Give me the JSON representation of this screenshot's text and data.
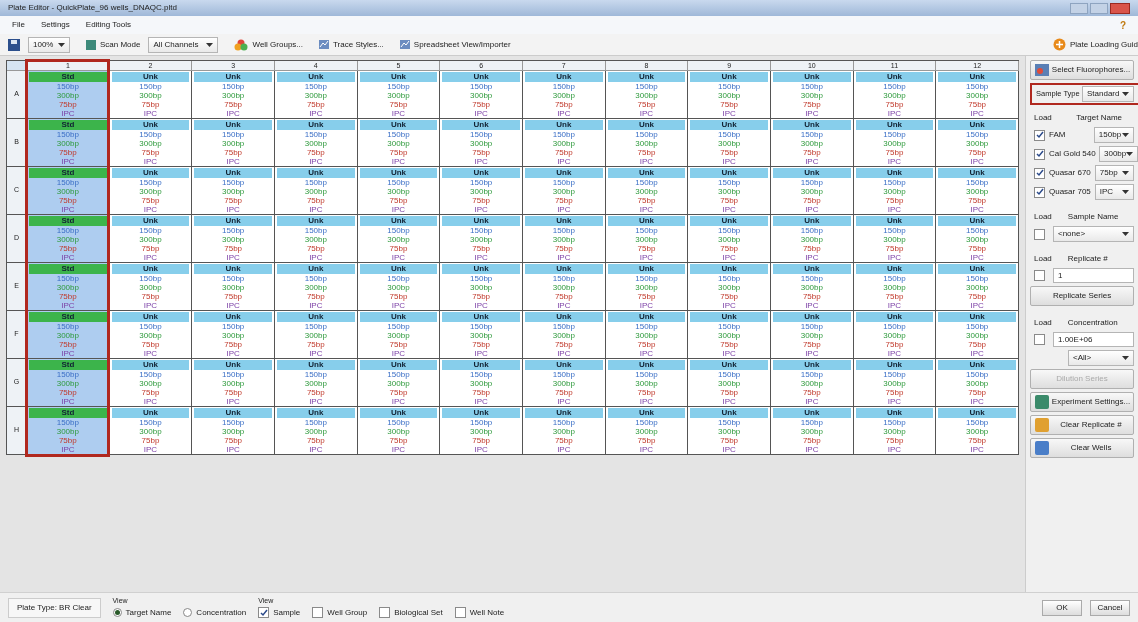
{
  "window": {
    "title": "Plate Editor - QuickPlate_96 wells_DNAQC.pltd"
  },
  "menu": [
    {
      "label": "File"
    },
    {
      "label": "Settings"
    },
    {
      "label": "Editing Tools"
    }
  ],
  "help": "?",
  "toolbar": {
    "zoom": "100%",
    "scan_mode_label": "Scan Mode",
    "scan_mode": "All Channels",
    "buttons": [
      "Well Groups...",
      "Trace Styles...",
      "Spreadsheet View/Importer"
    ],
    "guide": "Plate Loading Guid"
  },
  "columns": [
    "1",
    "2",
    "3",
    "4",
    "5",
    "6",
    "7",
    "8",
    "9",
    "10",
    "11",
    "12"
  ],
  "rows": [
    {
      "label": "A",
      "wells": [
        {
          "kind": "std",
          "label": "Std",
          "selected": true,
          "targets": [
            "150bp",
            "300bp",
            "75bp",
            "IPC"
          ]
        },
        {
          "kind": "unk",
          "label": "Unk",
          "selected": false,
          "targets": [
            "150bp",
            "300bp",
            "75bp",
            "IPC"
          ]
        },
        {
          "kind": "unk",
          "label": "Unk",
          "selected": false,
          "targets": [
            "150bp",
            "300bp",
            "75bp",
            "IPC"
          ]
        },
        {
          "kind": "unk",
          "label": "Unk",
          "selected": false,
          "targets": [
            "150bp",
            "300bp",
            "75bp",
            "IPC"
          ]
        },
        {
          "kind": "unk",
          "label": "Unk",
          "selected": false,
          "targets": [
            "150bp",
            "300bp",
            "75bp",
            "IPC"
          ]
        },
        {
          "kind": "unk",
          "label": "Unk",
          "selected": false,
          "targets": [
            "150bp",
            "300bp",
            "75bp",
            "IPC"
          ]
        },
        {
          "kind": "unk",
          "label": "Unk",
          "selected": false,
          "targets": [
            "150bp",
            "300bp",
            "75bp",
            "IPC"
          ]
        },
        {
          "kind": "unk",
          "label": "Unk",
          "selected": false,
          "targets": [
            "150bp",
            "300bp",
            "75bp",
            "IPC"
          ]
        },
        {
          "kind": "unk",
          "label": "Unk",
          "selected": false,
          "targets": [
            "150bp",
            "300bp",
            "75bp",
            "IPC"
          ]
        },
        {
          "kind": "unk",
          "label": "Unk",
          "selected": false,
          "targets": [
            "150bp",
            "300bp",
            "75bp",
            "IPC"
          ]
        },
        {
          "kind": "unk",
          "label": "Unk",
          "selected": false,
          "targets": [
            "150bp",
            "300bp",
            "75bp",
            "IPC"
          ]
        },
        {
          "kind": "unk",
          "label": "Unk",
          "selected": false,
          "targets": [
            "150bp",
            "300bp",
            "75bp",
            "IPC"
          ]
        }
      ]
    },
    {
      "label": "B",
      "wells": [
        {
          "kind": "std",
          "label": "Std",
          "selected": true,
          "targets": [
            "150bp",
            "300bp",
            "75bp",
            "IPC"
          ]
        },
        {
          "kind": "unk",
          "label": "Unk",
          "selected": false,
          "targets": [
            "150bp",
            "300bp",
            "75bp",
            "IPC"
          ]
        },
        {
          "kind": "unk",
          "label": "Unk",
          "selected": false,
          "targets": [
            "150bp",
            "300bp",
            "75bp",
            "IPC"
          ]
        },
        {
          "kind": "unk",
          "label": "Unk",
          "selected": false,
          "targets": [
            "150bp",
            "300bp",
            "75bp",
            "IPC"
          ]
        },
        {
          "kind": "unk",
          "label": "Unk",
          "selected": false,
          "targets": [
            "150bp",
            "300bp",
            "75bp",
            "IPC"
          ]
        },
        {
          "kind": "unk",
          "label": "Unk",
          "selected": false,
          "targets": [
            "150bp",
            "300bp",
            "75bp",
            "IPC"
          ]
        },
        {
          "kind": "unk",
          "label": "Unk",
          "selected": false,
          "targets": [
            "150bp",
            "300bp",
            "75bp",
            "IPC"
          ]
        },
        {
          "kind": "unk",
          "label": "Unk",
          "selected": false,
          "targets": [
            "150bp",
            "300bp",
            "75bp",
            "IPC"
          ]
        },
        {
          "kind": "unk",
          "label": "Unk",
          "selected": false,
          "targets": [
            "150bp",
            "300bp",
            "75bp",
            "IPC"
          ]
        },
        {
          "kind": "unk",
          "label": "Unk",
          "selected": false,
          "targets": [
            "150bp",
            "300bp",
            "75bp",
            "IPC"
          ]
        },
        {
          "kind": "unk",
          "label": "Unk",
          "selected": false,
          "targets": [
            "150bp",
            "300bp",
            "75bp",
            "IPC"
          ]
        },
        {
          "kind": "unk",
          "label": "Unk",
          "selected": false,
          "targets": [
            "150bp",
            "300bp",
            "75bp",
            "IPC"
          ]
        }
      ]
    },
    {
      "label": "C",
      "wells": [
        {
          "kind": "std",
          "label": "Std",
          "selected": true,
          "targets": [
            "150bp",
            "300bp",
            "75bp",
            "IPC"
          ]
        },
        {
          "kind": "unk",
          "label": "Unk",
          "selected": false,
          "targets": [
            "150bp",
            "300bp",
            "75bp",
            "IPC"
          ]
        },
        {
          "kind": "unk",
          "label": "Unk",
          "selected": false,
          "targets": [
            "150bp",
            "300bp",
            "75bp",
            "IPC"
          ]
        },
        {
          "kind": "unk",
          "label": "Unk",
          "selected": false,
          "targets": [
            "150bp",
            "300bp",
            "75bp",
            "IPC"
          ]
        },
        {
          "kind": "unk",
          "label": "Unk",
          "selected": false,
          "targets": [
            "150bp",
            "300bp",
            "75bp",
            "IPC"
          ]
        },
        {
          "kind": "unk",
          "label": "Unk",
          "selected": false,
          "targets": [
            "150bp",
            "300bp",
            "75bp",
            "IPC"
          ]
        },
        {
          "kind": "unk",
          "label": "Unk",
          "selected": false,
          "targets": [
            "150bp",
            "300bp",
            "75bp",
            "IPC"
          ]
        },
        {
          "kind": "unk",
          "label": "Unk",
          "selected": false,
          "targets": [
            "150bp",
            "300bp",
            "75bp",
            "IPC"
          ]
        },
        {
          "kind": "unk",
          "label": "Unk",
          "selected": false,
          "targets": [
            "150bp",
            "300bp",
            "75bp",
            "IPC"
          ]
        },
        {
          "kind": "unk",
          "label": "Unk",
          "selected": false,
          "targets": [
            "150bp",
            "300bp",
            "75bp",
            "IPC"
          ]
        },
        {
          "kind": "unk",
          "label": "Unk",
          "selected": false,
          "targets": [
            "150bp",
            "300bp",
            "75bp",
            "IPC"
          ]
        },
        {
          "kind": "unk",
          "label": "Unk",
          "selected": false,
          "targets": [
            "150bp",
            "300bp",
            "75bp",
            "IPC"
          ]
        }
      ]
    },
    {
      "label": "D",
      "wells": [
        {
          "kind": "std",
          "label": "Std",
          "selected": true,
          "targets": [
            "150bp",
            "300bp",
            "75bp",
            "IPC"
          ]
        },
        {
          "kind": "unk",
          "label": "Unk",
          "selected": false,
          "targets": [
            "150bp",
            "300bp",
            "75bp",
            "IPC"
          ]
        },
        {
          "kind": "unk",
          "label": "Unk",
          "selected": false,
          "targets": [
            "150bp",
            "300bp",
            "75bp",
            "IPC"
          ]
        },
        {
          "kind": "unk",
          "label": "Unk",
          "selected": false,
          "targets": [
            "150bp",
            "300bp",
            "75bp",
            "IPC"
          ]
        },
        {
          "kind": "unk",
          "label": "Unk",
          "selected": false,
          "targets": [
            "150bp",
            "300bp",
            "75bp",
            "IPC"
          ]
        },
        {
          "kind": "unk",
          "label": "Unk",
          "selected": false,
          "targets": [
            "150bp",
            "300bp",
            "75bp",
            "IPC"
          ]
        },
        {
          "kind": "unk",
          "label": "Unk",
          "selected": false,
          "targets": [
            "150bp",
            "300bp",
            "75bp",
            "IPC"
          ]
        },
        {
          "kind": "unk",
          "label": "Unk",
          "selected": false,
          "targets": [
            "150bp",
            "300bp",
            "75bp",
            "IPC"
          ]
        },
        {
          "kind": "unk",
          "label": "Unk",
          "selected": false,
          "targets": [
            "150bp",
            "300bp",
            "75bp",
            "IPC"
          ]
        },
        {
          "kind": "unk",
          "label": "Unk",
          "selected": false,
          "targets": [
            "150bp",
            "300bp",
            "75bp",
            "IPC"
          ]
        },
        {
          "kind": "unk",
          "label": "Unk",
          "selected": false,
          "targets": [
            "150bp",
            "300bp",
            "75bp",
            "IPC"
          ]
        },
        {
          "kind": "unk",
          "label": "Unk",
          "selected": false,
          "targets": [
            "150bp",
            "300bp",
            "75bp",
            "IPC"
          ]
        }
      ]
    },
    {
      "label": "E",
      "wells": [
        {
          "kind": "std",
          "label": "Std",
          "selected": true,
          "targets": [
            "150bp",
            "300bp",
            "75bp",
            "IPC"
          ]
        },
        {
          "kind": "unk",
          "label": "Unk",
          "selected": false,
          "targets": [
            "150bp",
            "300bp",
            "75bp",
            "IPC"
          ]
        },
        {
          "kind": "unk",
          "label": "Unk",
          "selected": false,
          "targets": [
            "150bp",
            "300bp",
            "75bp",
            "IPC"
          ]
        },
        {
          "kind": "unk",
          "label": "Unk",
          "selected": false,
          "targets": [
            "150bp",
            "300bp",
            "75bp",
            "IPC"
          ]
        },
        {
          "kind": "unk",
          "label": "Unk",
          "selected": false,
          "targets": [
            "150bp",
            "300bp",
            "75bp",
            "IPC"
          ]
        },
        {
          "kind": "unk",
          "label": "Unk",
          "selected": false,
          "targets": [
            "150bp",
            "300bp",
            "75bp",
            "IPC"
          ]
        },
        {
          "kind": "unk",
          "label": "Unk",
          "selected": false,
          "targets": [
            "150bp",
            "300bp",
            "75bp",
            "IPC"
          ]
        },
        {
          "kind": "unk",
          "label": "Unk",
          "selected": false,
          "targets": [
            "150bp",
            "300bp",
            "75bp",
            "IPC"
          ]
        },
        {
          "kind": "unk",
          "label": "Unk",
          "selected": false,
          "targets": [
            "150bp",
            "300bp",
            "75bp",
            "IPC"
          ]
        },
        {
          "kind": "unk",
          "label": "Unk",
          "selected": false,
          "targets": [
            "150bp",
            "300bp",
            "75bp",
            "IPC"
          ]
        },
        {
          "kind": "unk",
          "label": "Unk",
          "selected": false,
          "targets": [
            "150bp",
            "300bp",
            "75bp",
            "IPC"
          ]
        },
        {
          "kind": "unk",
          "label": "Unk",
          "selected": false,
          "targets": [
            "150bp",
            "300bp",
            "75bp",
            "IPC"
          ]
        }
      ]
    },
    {
      "label": "F",
      "wells": [
        {
          "kind": "std",
          "label": "Std",
          "selected": true,
          "targets": [
            "150bp",
            "300bp",
            "75bp",
            "IPC"
          ]
        },
        {
          "kind": "unk",
          "label": "Unk",
          "selected": false,
          "targets": [
            "150bp",
            "300bp",
            "75bp",
            "IPC"
          ]
        },
        {
          "kind": "unk",
          "label": "Unk",
          "selected": false,
          "targets": [
            "150bp",
            "300bp",
            "75bp",
            "IPC"
          ]
        },
        {
          "kind": "unk",
          "label": "Unk",
          "selected": false,
          "targets": [
            "150bp",
            "300bp",
            "75bp",
            "IPC"
          ]
        },
        {
          "kind": "unk",
          "label": "Unk",
          "selected": false,
          "targets": [
            "150bp",
            "300bp",
            "75bp",
            "IPC"
          ]
        },
        {
          "kind": "unk",
          "label": "Unk",
          "selected": false,
          "targets": [
            "150bp",
            "300bp",
            "75bp",
            "IPC"
          ]
        },
        {
          "kind": "unk",
          "label": "Unk",
          "selected": false,
          "targets": [
            "150bp",
            "300bp",
            "75bp",
            "IPC"
          ]
        },
        {
          "kind": "unk",
          "label": "Unk",
          "selected": false,
          "targets": [
            "150bp",
            "300bp",
            "75bp",
            "IPC"
          ]
        },
        {
          "kind": "unk",
          "label": "Unk",
          "selected": false,
          "targets": [
            "150bp",
            "300bp",
            "75bp",
            "IPC"
          ]
        },
        {
          "kind": "unk",
          "label": "Unk",
          "selected": false,
          "targets": [
            "150bp",
            "300bp",
            "75bp",
            "IPC"
          ]
        },
        {
          "kind": "unk",
          "label": "Unk",
          "selected": false,
          "targets": [
            "150bp",
            "300bp",
            "75bp",
            "IPC"
          ]
        },
        {
          "kind": "unk",
          "label": "Unk",
          "selected": false,
          "targets": [
            "150bp",
            "300bp",
            "75bp",
            "IPC"
          ]
        }
      ]
    },
    {
      "label": "G",
      "wells": [
        {
          "kind": "std",
          "label": "Std",
          "selected": true,
          "targets": [
            "150bp",
            "300bp",
            "75bp",
            "IPC"
          ]
        },
        {
          "kind": "unk",
          "label": "Unk",
          "selected": false,
          "targets": [
            "150bp",
            "300bp",
            "75bp",
            "IPC"
          ]
        },
        {
          "kind": "unk",
          "label": "Unk",
          "selected": false,
          "targets": [
            "150bp",
            "300bp",
            "75bp",
            "IPC"
          ]
        },
        {
          "kind": "unk",
          "label": "Unk",
          "selected": false,
          "targets": [
            "150bp",
            "300bp",
            "75bp",
            "IPC"
          ]
        },
        {
          "kind": "unk",
          "label": "Unk",
          "selected": false,
          "targets": [
            "150bp",
            "300bp",
            "75bp",
            "IPC"
          ]
        },
        {
          "kind": "unk",
          "label": "Unk",
          "selected": false,
          "targets": [
            "150bp",
            "300bp",
            "75bp",
            "IPC"
          ]
        },
        {
          "kind": "unk",
          "label": "Unk",
          "selected": false,
          "targets": [
            "150bp",
            "300bp",
            "75bp",
            "IPC"
          ]
        },
        {
          "kind": "unk",
          "label": "Unk",
          "selected": false,
          "targets": [
            "150bp",
            "300bp",
            "75bp",
            "IPC"
          ]
        },
        {
          "kind": "unk",
          "label": "Unk",
          "selected": false,
          "targets": [
            "150bp",
            "300bp",
            "75bp",
            "IPC"
          ]
        },
        {
          "kind": "unk",
          "label": "Unk",
          "selected": false,
          "targets": [
            "150bp",
            "300bp",
            "75bp",
            "IPC"
          ]
        },
        {
          "kind": "unk",
          "label": "Unk",
          "selected": false,
          "targets": [
            "150bp",
            "300bp",
            "75bp",
            "IPC"
          ]
        },
        {
          "kind": "unk",
          "label": "Unk",
          "selected": false,
          "targets": [
            "150bp",
            "300bp",
            "75bp",
            "IPC"
          ]
        }
      ]
    },
    {
      "label": "H",
      "wells": [
        {
          "kind": "std",
          "label": "Std",
          "selected": true,
          "targets": [
            "150bp",
            "300bp",
            "75bp",
            "IPC"
          ]
        },
        {
          "kind": "unk",
          "label": "Unk",
          "selected": false,
          "targets": [
            "150bp",
            "300bp",
            "75bp",
            "IPC"
          ]
        },
        {
          "kind": "unk",
          "label": "Unk",
          "selected": false,
          "targets": [
            "150bp",
            "300bp",
            "75bp",
            "IPC"
          ]
        },
        {
          "kind": "unk",
          "label": "Unk",
          "selected": false,
          "targets": [
            "150bp",
            "300bp",
            "75bp",
            "IPC"
          ]
        },
        {
          "kind": "unk",
          "label": "Unk",
          "selected": false,
          "targets": [
            "150bp",
            "300bp",
            "75bp",
            "IPC"
          ]
        },
        {
          "kind": "unk",
          "label": "Unk",
          "selected": false,
          "targets": [
            "150bp",
            "300bp",
            "75bp",
            "IPC"
          ]
        },
        {
          "kind": "unk",
          "label": "Unk",
          "selected": false,
          "targets": [
            "150bp",
            "300bp",
            "75bp",
            "IPC"
          ]
        },
        {
          "kind": "unk",
          "label": "Unk",
          "selected": false,
          "targets": [
            "150bp",
            "300bp",
            "75bp",
            "IPC"
          ]
        },
        {
          "kind": "unk",
          "label": "Unk",
          "selected": false,
          "targets": [
            "150bp",
            "300bp",
            "75bp",
            "IPC"
          ]
        },
        {
          "kind": "unk",
          "label": "Unk",
          "selected": false,
          "targets": [
            "150bp",
            "300bp",
            "75bp",
            "IPC"
          ]
        },
        {
          "kind": "unk",
          "label": "Unk",
          "selected": false,
          "targets": [
            "150bp",
            "300bp",
            "75bp",
            "IPC"
          ]
        },
        {
          "kind": "unk",
          "label": "Unk",
          "selected": false,
          "targets": [
            "150bp",
            "300bp",
            "75bp",
            "IPC"
          ]
        }
      ]
    }
  ],
  "panel": {
    "select_fluorophores": "Select Fluorophores...",
    "sample_type_label": "Sample Type",
    "sample_type": "Standard",
    "load_label": "Load",
    "target_name_label": "Target Name",
    "targets": [
      {
        "fluorophore": "FAM",
        "target": "150bp",
        "checked": true
      },
      {
        "fluorophore": "Cal Gold 540",
        "target": "300bp",
        "checked": true
      },
      {
        "fluorophore": "Quasar 670",
        "target": "75bp",
        "checked": true
      },
      {
        "fluorophore": "Quasar 705",
        "target": "IPC",
        "checked": true
      }
    ],
    "sample_name": {
      "load": "Load",
      "label": "Sample Name",
      "checked": false,
      "value": "<none>"
    },
    "replicate": {
      "load": "Load",
      "label": "Replicate #",
      "checked": false,
      "value": "1",
      "button": "Replicate Series"
    },
    "concentration": {
      "load": "Load",
      "label": "Concentration",
      "checked": false,
      "value": "1.00E+06",
      "unit": "<All>",
      "button": "Dilution Series",
      "button_disabled": true
    },
    "actions": [
      "Experiment Settings...",
      "Clear Replicate #",
      "Clear Wells"
    ]
  },
  "footer": {
    "plate_type": "Plate Type: BR Clear",
    "view_label_1": "View",
    "radios": [
      {
        "label": "Target Name",
        "selected": true
      },
      {
        "label": "Concentration",
        "selected": false
      }
    ],
    "view_label_2": "View",
    "checks": [
      {
        "label": "Sample",
        "checked": true
      },
      {
        "label": "Well Group",
        "checked": false
      },
      {
        "label": "Biological Set",
        "checked": false
      },
      {
        "label": "Well Note",
        "checked": false
      }
    ],
    "ok": "OK",
    "cancel": "Cancel"
  }
}
